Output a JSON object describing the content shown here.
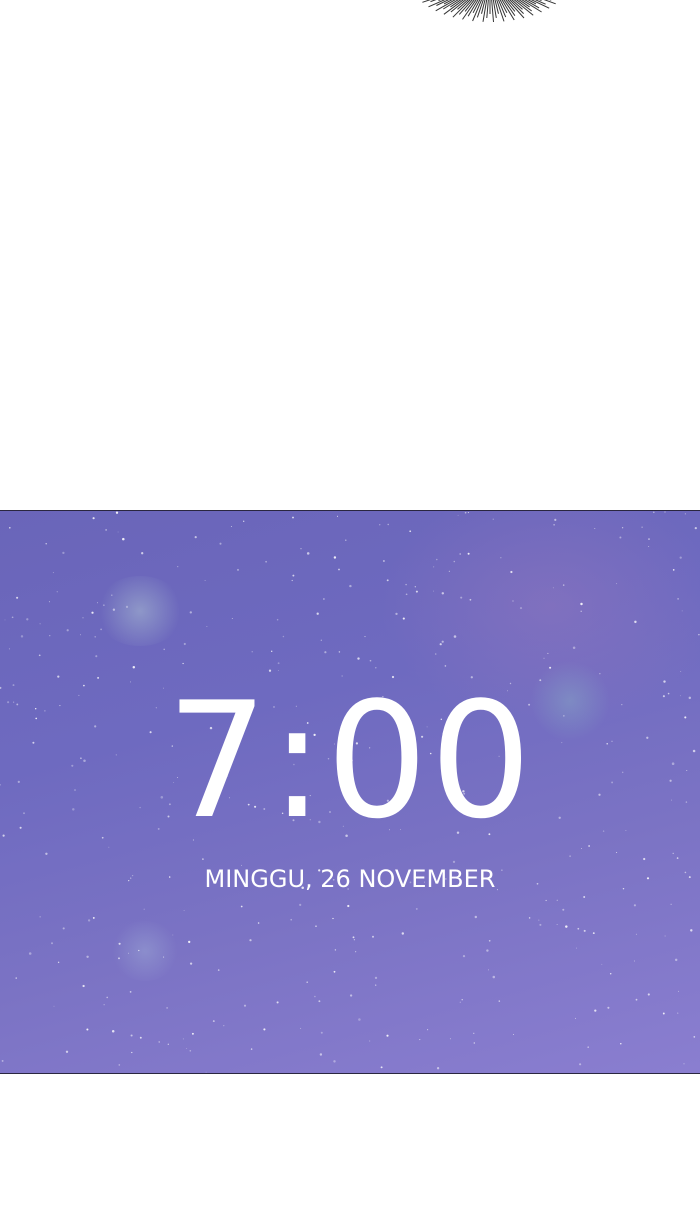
{
  "lock_screen": {
    "time": "7:00",
    "date": "MINGGU, 26 NOVEMBER"
  },
  "colors": {
    "background": "#ffffff",
    "sky": "#6e6ac0",
    "text": "#ffffff"
  },
  "icons": {
    "top_decoration": "hair-strands-drawing"
  }
}
